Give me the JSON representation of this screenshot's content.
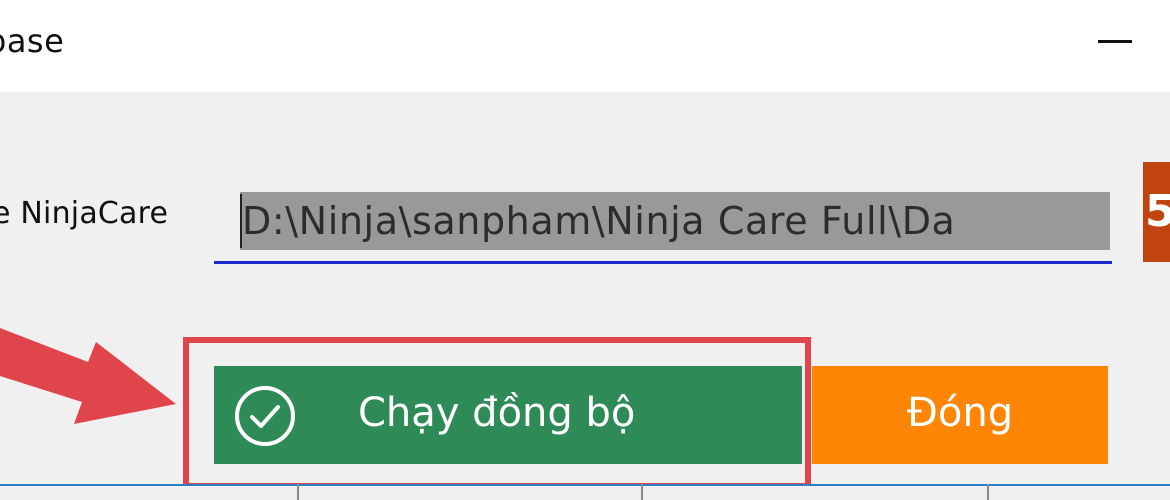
{
  "window": {
    "title": "base"
  },
  "form": {
    "field_label": "e NinjaCare",
    "path_value": "D:\\Ninja\\sanpham\\Ninja Care Full\\Da",
    "browse_label": "5"
  },
  "actions": {
    "sync_label": "Chạy đồng bộ",
    "close_label": "Đóng"
  },
  "icons": {
    "sync": "check-circle-icon",
    "minimize": "minimize-icon",
    "annotation": "arrow-right-icon"
  },
  "colors": {
    "sync_button": "#2e8b57",
    "close_button": "#ff8507",
    "browse_button": "#c1440e",
    "highlight": "#e0454b",
    "input_underline": "#1a29c9",
    "selection": "#999999"
  }
}
